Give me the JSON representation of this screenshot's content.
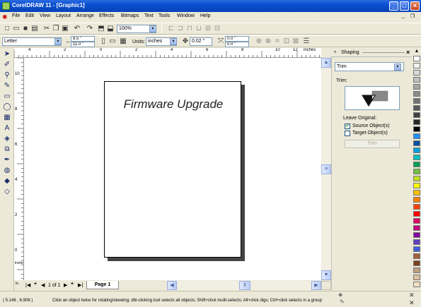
{
  "window": {
    "title": "CorelDRAW 11 - [Graphic1]"
  },
  "menu": [
    "File",
    "Edit",
    "View",
    "Layout",
    "Arrange",
    "Effects",
    "Bitmaps",
    "Text",
    "Tools",
    "Window",
    "Help"
  ],
  "standard_toolbar": {
    "zoom_value": "100%"
  },
  "property_bar": {
    "paper_type": "Letter",
    "width": "8.5 \"",
    "height": "11.0 \"",
    "units_label": "Units:",
    "units_value": "inches",
    "nudge": "0.02 \"",
    "dup_x": "0.0 \"",
    "dup_y": "0.0 \""
  },
  "ruler": {
    "h_labels": [
      "4",
      "2",
      "0",
      "2",
      "4",
      "6",
      "8",
      "10",
      "12"
    ],
    "h_unit": "inches",
    "v_labels": [
      "10",
      "8",
      "6",
      "4",
      "2",
      "0"
    ],
    "v_unit": "inches"
  },
  "page": {
    "text": "Firmware Upgrade"
  },
  "page_nav": {
    "counter": "1 of 1",
    "tab": "Page 1"
  },
  "docker": {
    "title": "Shaping",
    "mode": "Trim",
    "section_label": "Trim:",
    "leave_original_label": "Leave Original:",
    "source_label": "Source Object(s)",
    "target_label": "Target Object(s)",
    "trim_button": "Trim",
    "source_checked": true,
    "target_checked": false
  },
  "palette_colors": [
    "#ffffff",
    "#f2f2f2",
    "#d9d9d9",
    "#bfbfbf",
    "#a6a6a6",
    "#8c8c8c",
    "#737373",
    "#595959",
    "#404040",
    "#262626",
    "#000000",
    "#1e90ff",
    "#0050a0",
    "#00a0e0",
    "#00c0c0",
    "#00a050",
    "#70c040",
    "#c0e020",
    "#ffff00",
    "#ffc000",
    "#ff8000",
    "#ff4000",
    "#ff0000",
    "#e00060",
    "#c00080",
    "#8000a0",
    "#6040c0",
    "#4060e0",
    "#a06040",
    "#804020",
    "#c0a080",
    "#e0c0a0",
    "#f0e0c0"
  ],
  "status": {
    "coords": "( 5.146 , 6.908 )",
    "message": "Click an object twice for rotating/skewing; dbl-clicking tool selects all objects; Shift+click multi-selects; Alt+click digs; Ctrl+click selects in a group"
  },
  "colors": {
    "titlebar": "#0a4fd0",
    "chrome": "#ece9d8"
  }
}
